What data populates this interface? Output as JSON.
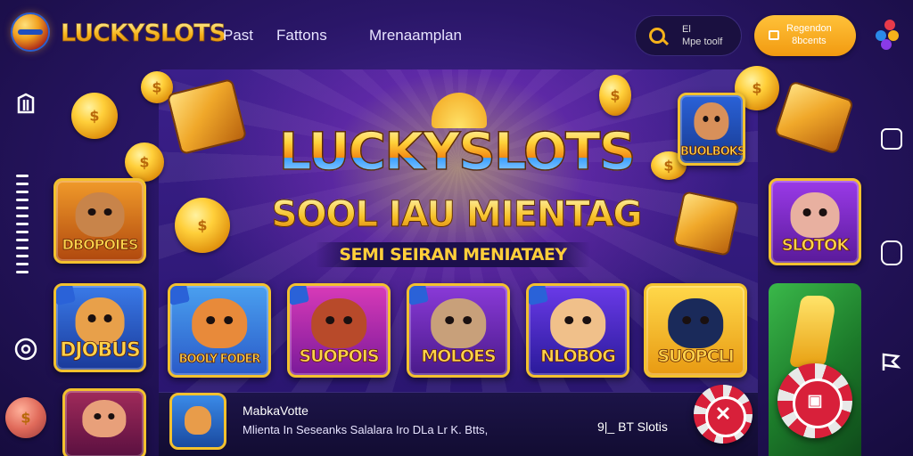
{
  "header": {
    "logo_text": "LUCKYSLOTS",
    "nav": [
      "Past",
      "Fattons",
      "Mrenaamplan"
    ],
    "search_text_line1": "El",
    "search_text_line2": "Mpe toolf",
    "register_line1": "Regendon",
    "register_line2": "8bcents"
  },
  "hero": {
    "title": "LUCKYSLOTS",
    "subtitle": "SOOL IAU MIENTAG",
    "tagline": "SEMI SEIRAN MENIATAEY"
  },
  "tiles": {
    "featured_top": "BUOLBOKS",
    "left_top": "DBOPOIES",
    "left_mid": "DJOBUS",
    "right_top": "SLOTOK",
    "row": [
      "BOOLY FODER",
      "SUOPOIS",
      "MOLOES",
      "NLOBOG",
      "SUOPCLI"
    ]
  },
  "bottom": {
    "title": "MabkaVotte",
    "description": "Mlienta In Seseanks Salalara Iro DLa Lr K. Btts,",
    "count": "9|_ BT Slotis"
  },
  "colors": {
    "accent": "#f6b21a",
    "bg_dark": "#160c3e",
    "bg_mid": "#2a1668",
    "chip_red": "#d8203a"
  }
}
